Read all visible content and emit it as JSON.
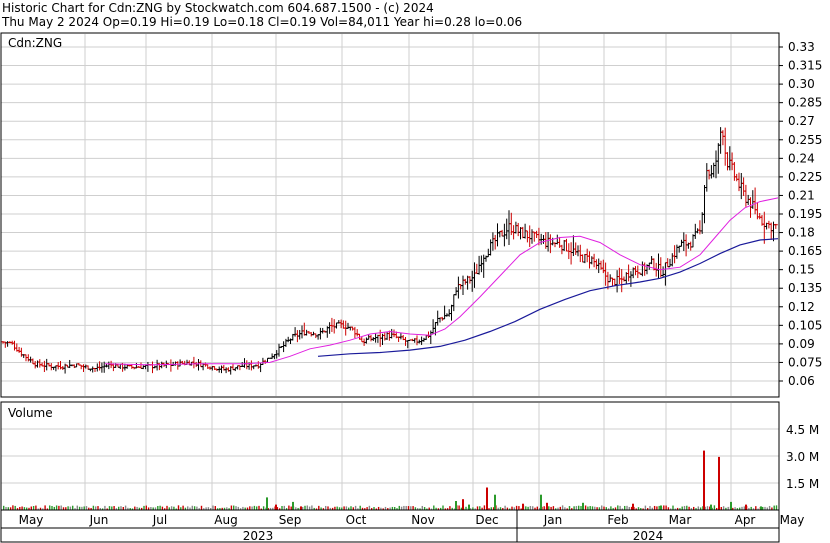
{
  "header": {
    "line1": "Historic Chart for Cdn:ZNG by Stockwatch.com 604.687.1500 - (c) 2024",
    "line2": "Thu May  2 2024   Op=0.19  Hi=0.19  Lo=0.18  Cl=0.19  Vol=84,011  Year hi=0.28  lo=0.06"
  },
  "chart_data": [
    {
      "type": "ohlc",
      "title": "Cdn:ZNG",
      "ylim": [
        0.045,
        0.34
      ],
      "y_ticks": [
        "0.33",
        "0.315",
        "0.30",
        "0.285",
        "0.27",
        "0.255",
        "0.24",
        "0.225",
        "0.21",
        "0.195",
        "0.18",
        "0.165",
        "0.15",
        "0.135",
        "0.12",
        "0.105",
        "0.09",
        "0.075",
        "0.06"
      ],
      "y_tick_values": [
        0.33,
        0.315,
        0.3,
        0.285,
        0.27,
        0.255,
        0.24,
        0.225,
        0.21,
        0.195,
        0.18,
        0.165,
        0.15,
        0.135,
        0.12,
        0.105,
        0.09,
        0.075,
        0.06
      ],
      "x_months": [
        "May",
        "Jun",
        "Jul",
        "Aug",
        "Sep",
        "Oct",
        "Nov",
        "Dec",
        "Jan",
        "Feb",
        "Mar",
        "Apr",
        "May"
      ],
      "x_years": [
        "2023",
        "2024"
      ],
      "grid": true,
      "price_colors": {
        "up": "#000000",
        "down": "#cc0000",
        "ma_short": "#e020e0",
        "ma_long": "#1a1a9a"
      },
      "price_segments": [
        [
          0,
          0.092
        ],
        [
          12,
          0.09
        ],
        [
          22,
          0.082
        ],
        [
          35,
          0.074
        ],
        [
          50,
          0.072
        ],
        [
          62,
          0.072
        ],
        [
          75,
          0.073
        ],
        [
          95,
          0.07
        ],
        [
          110,
          0.073
        ],
        [
          130,
          0.071
        ],
        [
          150,
          0.072
        ],
        [
          170,
          0.073
        ],
        [
          190,
          0.075
        ],
        [
          210,
          0.072
        ],
        [
          225,
          0.069
        ],
        [
          240,
          0.072
        ],
        [
          258,
          0.073
        ],
        [
          268,
          0.078
        ],
        [
          280,
          0.086
        ],
        [
          292,
          0.095
        ],
        [
          305,
          0.1
        ],
        [
          320,
          0.098
        ],
        [
          330,
          0.104
        ],
        [
          345,
          0.105
        ],
        [
          355,
          0.1
        ],
        [
          362,
          0.092
        ],
        [
          375,
          0.095
        ],
        [
          390,
          0.097
        ],
        [
          400,
          0.094
        ],
        [
          410,
          0.091
        ],
        [
          420,
          0.093
        ],
        [
          430,
          0.098
        ],
        [
          438,
          0.11
        ],
        [
          450,
          0.115
        ],
        [
          456,
          0.135
        ],
        [
          465,
          0.14
        ],
        [
          475,
          0.145
        ],
        [
          482,
          0.16
        ],
        [
          492,
          0.17
        ],
        [
          500,
          0.178
        ],
        [
          510,
          0.185
        ],
        [
          520,
          0.18
        ],
        [
          530,
          0.177
        ],
        [
          545,
          0.172
        ],
        [
          560,
          0.171
        ],
        [
          572,
          0.166
        ],
        [
          580,
          0.16
        ],
        [
          592,
          0.158
        ],
        [
          602,
          0.148
        ],
        [
          612,
          0.14
        ],
        [
          622,
          0.142
        ],
        [
          632,
          0.15
        ],
        [
          642,
          0.15
        ],
        [
          652,
          0.155
        ],
        [
          662,
          0.148
        ],
        [
          672,
          0.16
        ],
        [
          680,
          0.17
        ],
        [
          690,
          0.172
        ],
        [
          700,
          0.18
        ],
        [
          706,
          0.232
        ],
        [
          712,
          0.225
        ],
        [
          718,
          0.245
        ],
        [
          722,
          0.27
        ],
        [
          726,
          0.24
        ],
        [
          732,
          0.23
        ],
        [
          738,
          0.22
        ],
        [
          744,
          0.21
        ],
        [
          750,
          0.205
        ],
        [
          756,
          0.195
        ],
        [
          762,
          0.19
        ],
        [
          768,
          0.186
        ],
        [
          776,
          0.185
        ]
      ],
      "ma_short": [
        [
          105,
          0.074
        ],
        [
          150,
          0.073
        ],
        [
          200,
          0.074
        ],
        [
          245,
          0.074
        ],
        [
          270,
          0.075
        ],
        [
          290,
          0.08
        ],
        [
          310,
          0.086
        ],
        [
          330,
          0.089
        ],
        [
          350,
          0.093
        ],
        [
          370,
          0.098
        ],
        [
          390,
          0.1
        ],
        [
          410,
          0.098
        ],
        [
          430,
          0.097
        ],
        [
          445,
          0.102
        ],
        [
          460,
          0.112
        ],
        [
          480,
          0.128
        ],
        [
          500,
          0.145
        ],
        [
          520,
          0.162
        ],
        [
          540,
          0.172
        ],
        [
          560,
          0.176
        ],
        [
          580,
          0.177
        ],
        [
          600,
          0.172
        ],
        [
          620,
          0.162
        ],
        [
          640,
          0.154
        ],
        [
          660,
          0.15
        ],
        [
          680,
          0.152
        ],
        [
          700,
          0.162
        ],
        [
          715,
          0.176
        ],
        [
          730,
          0.19
        ],
        [
          745,
          0.2
        ],
        [
          760,
          0.205
        ],
        [
          778,
          0.208
        ]
      ],
      "ma_long": [
        [
          318,
          0.08
        ],
        [
          350,
          0.082
        ],
        [
          380,
          0.083
        ],
        [
          410,
          0.085
        ],
        [
          440,
          0.088
        ],
        [
          465,
          0.093
        ],
        [
          490,
          0.1
        ],
        [
          515,
          0.108
        ],
        [
          540,
          0.118
        ],
        [
          565,
          0.126
        ],
        [
          590,
          0.133
        ],
        [
          615,
          0.137
        ],
        [
          640,
          0.14
        ],
        [
          660,
          0.143
        ],
        [
          680,
          0.148
        ],
        [
          700,
          0.155
        ],
        [
          720,
          0.163
        ],
        [
          740,
          0.17
        ],
        [
          760,
          0.174
        ],
        [
          778,
          0.175
        ]
      ]
    },
    {
      "type": "bar",
      "title": "Volume",
      "y_ticks": [
        "4.5 M",
        "3.0 M",
        "1.5 M"
      ],
      "y_tick_values": [
        4500000,
        3000000,
        1500000
      ],
      "ylim": [
        0,
        5800000
      ],
      "spikes": [
        [
          266,
          700000
        ],
        [
          275,
          300000
        ],
        [
          292,
          450000
        ],
        [
          300,
          200000
        ],
        [
          455,
          500000
        ],
        [
          462,
          600000
        ],
        [
          468,
          300000
        ],
        [
          486,
          1250000
        ],
        [
          494,
          850000
        ],
        [
          522,
          350000
        ],
        [
          540,
          850000
        ],
        [
          546,
          400000
        ],
        [
          582,
          400000
        ],
        [
          632,
          350000
        ],
        [
          660,
          250000
        ],
        [
          703,
          3300000
        ],
        [
          710,
          300000
        ],
        [
          718,
          2950000
        ],
        [
          730,
          450000
        ],
        [
          745,
          300000
        ],
        [
          760,
          200000
        ]
      ]
    }
  ]
}
